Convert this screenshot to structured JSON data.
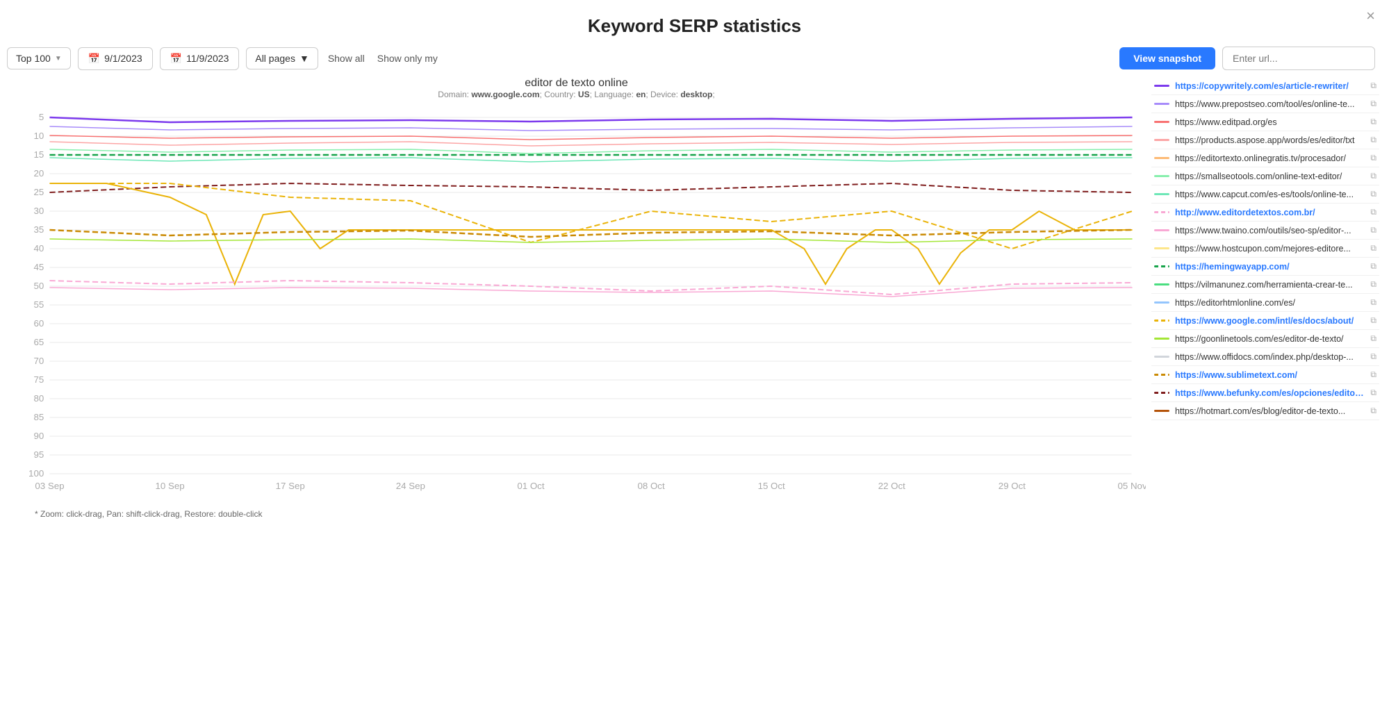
{
  "page": {
    "title": "Keyword SERP statistics",
    "close_label": "×"
  },
  "toolbar": {
    "top_label": "Top 100",
    "date_start": "9/1/2023",
    "date_end": "11/9/2023",
    "pages_label": "All pages",
    "show_all_label": "Show all",
    "show_only_label": "Show only my",
    "view_snapshot_label": "View snapshot",
    "url_search_placeholder": "Enter url..."
  },
  "chart": {
    "main_title": "editor de texto online",
    "sub_title_domain": "www.google.com",
    "sub_title_country": "US",
    "sub_title_language": "en",
    "sub_title_device": "desktop",
    "zoom_hint": "* Zoom: click-drag, Pan: shift-click-drag, Restore: double-click",
    "x_labels": [
      "03 Sep",
      "10 Sep",
      "17 Sep",
      "24 Sep",
      "01 Oct",
      "08 Oct",
      "15 Oct",
      "22 Oct",
      "29 Oct",
      "05 Nov"
    ],
    "y_labels": [
      "5",
      "10",
      "15",
      "20",
      "25",
      "30",
      "35",
      "40",
      "45",
      "50",
      "55",
      "60",
      "65",
      "70",
      "75",
      "80",
      "85",
      "90",
      "95",
      "100"
    ]
  },
  "legend": [
    {
      "url": "https://copywritely.com/es/article-rewriter/",
      "color": "#7c3aed",
      "highlighted": true,
      "dashed": false
    },
    {
      "url": "https://www.prepostseo.com/tool/es/online-te...",
      "color": "#a78bfa",
      "highlighted": false,
      "dashed": false
    },
    {
      "url": "https://www.editpad.org/es",
      "color": "#f87171",
      "highlighted": false,
      "dashed": false
    },
    {
      "url": "https://products.aspose.app/words/es/editor/txt",
      "color": "#fca5a5",
      "highlighted": false,
      "dashed": false
    },
    {
      "url": "https://editortexto.onlinegratis.tv/procesador/",
      "color": "#fdba74",
      "highlighted": false,
      "dashed": false
    },
    {
      "url": "https://smallseotools.com/online-text-editor/",
      "color": "#86efac",
      "highlighted": false,
      "dashed": false
    },
    {
      "url": "https://www.capcut.com/es-es/tools/online-te...",
      "color": "#6ee7b7",
      "highlighted": false,
      "dashed": false
    },
    {
      "url": "http://www.editordetextos.com.br/",
      "color": "#f9a8d4",
      "highlighted": true,
      "dashed": true
    },
    {
      "url": "https://www.twaino.com/outils/seo-sp/editor-...",
      "color": "#f9a8d4",
      "highlighted": false,
      "dashed": false
    },
    {
      "url": "https://www.hostcupon.com/mejores-editore...",
      "color": "#fde68a",
      "highlighted": false,
      "dashed": false
    },
    {
      "url": "https://hemingwayapp.com/",
      "color": "#16a34a",
      "highlighted": true,
      "dashed": true
    },
    {
      "url": "https://vilmanunez.com/herramienta-crear-te...",
      "color": "#4ade80",
      "highlighted": false,
      "dashed": false
    },
    {
      "url": "https://editorhtmlonline.com/es/",
      "color": "#93c5fd",
      "highlighted": false,
      "dashed": false
    },
    {
      "url": "https://www.google.com/intl/es/docs/about/",
      "color": "#eab308",
      "highlighted": true,
      "dashed": true
    },
    {
      "url": "https://goonlinetools.com/es/editor-de-texto/",
      "color": "#a3e635",
      "highlighted": false,
      "dashed": false
    },
    {
      "url": "https://www.offidocs.com/index.php/desktop-...",
      "color": "#d1d5db",
      "highlighted": false,
      "dashed": false
    },
    {
      "url": "https://www.sublimetext.com/",
      "color": "#ca8a04",
      "highlighted": true,
      "dashed": true
    },
    {
      "url": "https://www.befunky.com/es/opciones/editor-...",
      "color": "#7f1d1d",
      "highlighted": true,
      "dashed": true
    },
    {
      "url": "https://hotmart.com/es/blog/editor-de-texto...",
      "color": "#b45309",
      "highlighted": false,
      "dashed": false
    }
  ]
}
